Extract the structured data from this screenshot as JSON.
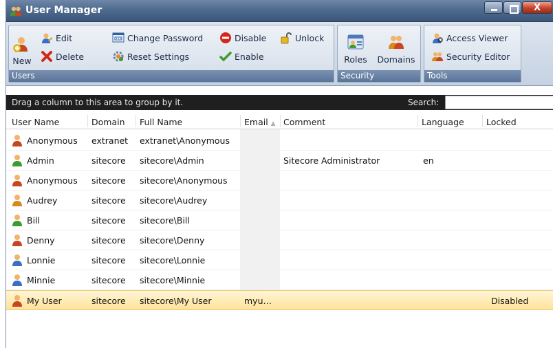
{
  "window": {
    "title": "User Manager",
    "controls": {
      "minimize": "–",
      "maximize": "□",
      "close": "X"
    }
  },
  "ribbon": {
    "users_group": {
      "label": "Users",
      "new": "New",
      "edit": "Edit",
      "delete": "Delete",
      "change_password": "Change Password",
      "reset_settings": "Reset Settings",
      "disable": "Disable",
      "enable": "Enable",
      "unlock": "Unlock"
    },
    "security_group": {
      "label": "Security",
      "roles": "Roles",
      "domains": "Domains"
    },
    "tools_group": {
      "label": "Tools",
      "access_viewer": "Access Viewer",
      "security_editor": "Security Editor"
    }
  },
  "groupbar": {
    "hint": "Drag a column to this area to group by it.",
    "search_label": "Search:",
    "search_value": ""
  },
  "grid": {
    "columns": [
      "User Name",
      "Domain",
      "Full Name",
      "Email",
      "Comment",
      "Language",
      "Locked"
    ],
    "sort_indicator": "▲",
    "rows": [
      {
        "user": "Anonymous",
        "domain": "extranet",
        "full_name": "extranet\\Anonymous",
        "email": "",
        "comment": "",
        "language": "",
        "locked": "",
        "icon": "user-red-icon",
        "icon_color": "#c8461f"
      },
      {
        "user": "Admin",
        "domain": "sitecore",
        "full_name": "sitecore\\Admin",
        "email": "",
        "comment": "Sitecore Administrator",
        "language": "en",
        "locked": "",
        "icon": "user-green-icon",
        "icon_color": "#3f9b2f"
      },
      {
        "user": "Anonymous",
        "domain": "sitecore",
        "full_name": "sitecore\\Anonymous",
        "email": "",
        "comment": "",
        "language": "",
        "locked": "",
        "icon": "user-red-icon",
        "icon_color": "#c8461f"
      },
      {
        "user": "Audrey",
        "domain": "sitecore",
        "full_name": "sitecore\\Audrey",
        "email": "",
        "comment": "",
        "language": "",
        "locked": "",
        "icon": "user-orange-icon",
        "icon_color": "#d98a1c"
      },
      {
        "user": "Bill",
        "domain": "sitecore",
        "full_name": "sitecore\\Bill",
        "email": "",
        "comment": "",
        "language": "",
        "locked": "",
        "icon": "user-green-icon",
        "icon_color": "#3f9b2f"
      },
      {
        "user": "Denny",
        "domain": "sitecore",
        "full_name": "sitecore\\Denny",
        "email": "",
        "comment": "",
        "language": "",
        "locked": "",
        "icon": "user-red-icon",
        "icon_color": "#c8461f"
      },
      {
        "user": "Lonnie",
        "domain": "sitecore",
        "full_name": "sitecore\\Lonnie",
        "email": "",
        "comment": "",
        "language": "",
        "locked": "",
        "icon": "user-blue-icon",
        "icon_color": "#3a6fc4"
      },
      {
        "user": "Minnie",
        "domain": "sitecore",
        "full_name": "sitecore\\Minnie",
        "email": "",
        "comment": "",
        "language": "",
        "locked": "",
        "icon": "user-blue-icon",
        "icon_color": "#3a6fc4"
      },
      {
        "user": "My User",
        "domain": "sitecore",
        "full_name": "sitecore\\My User",
        "email": "myu…",
        "comment": "",
        "language": "",
        "locked": "Disabled",
        "icon": "user-red-icon",
        "icon_color": "#c8461f",
        "selected": true
      }
    ]
  },
  "colors": {
    "titlebar": "#4e6b90",
    "ribbon": "#d3dde9",
    "group_label": "#5b7499",
    "groupbar": "#1f1f1f",
    "selected_row": "#ffe39a"
  }
}
